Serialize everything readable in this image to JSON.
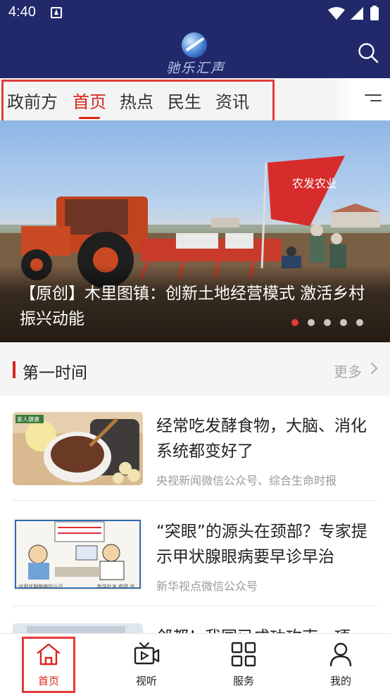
{
  "status_bar": {
    "time": "4:40"
  },
  "header": {
    "logo_text": "驰乐汇声",
    "search_icon": "search-icon"
  },
  "tabs": {
    "items": [
      {
        "label": "政前方",
        "active": false
      },
      {
        "label": "首页",
        "active": true
      },
      {
        "label": "热点",
        "active": false
      },
      {
        "label": "民生",
        "active": false
      },
      {
        "label": "资讯",
        "active": false
      }
    ],
    "menu_icon": "menu-icon"
  },
  "banner": {
    "title": "【原创】木里图镇：创新土地经营模式  激活乡村振兴动能",
    "flag_text": "农发农业",
    "slide_count": 5,
    "active_slide": 1
  },
  "section": {
    "title": "第一时间",
    "more": "更多"
  },
  "news": [
    {
      "title": "经常吃发酵食物，大脑、消化系统都变好了",
      "source": "央视新闻微信公众号、综合生命时报",
      "thumb_tag": "家人健康"
    },
    {
      "title": "“突眼”的源头在颈部？专家提示甲状腺眼病要早诊早治",
      "source": "新华视点微信公众号",
      "thumb_caption_left": "·对甲状腺眼病的认识",
      "thumb_caption_right": "新华社发 商锐 作"
    },
    {
      "title": "邻都！我国已成功攻克一项",
      "source": ""
    }
  ],
  "bottom_nav": {
    "items": [
      {
        "label": "首页",
        "icon": "home-icon",
        "active": true
      },
      {
        "label": "视听",
        "icon": "video-icon",
        "active": false
      },
      {
        "label": "服务",
        "icon": "grid-icon",
        "active": false
      },
      {
        "label": "我的",
        "icon": "user-icon",
        "active": false
      }
    ]
  },
  "colors": {
    "header_bg": "#21296b",
    "accent": "#d8251c",
    "highlight_box": "#e33b3b"
  }
}
